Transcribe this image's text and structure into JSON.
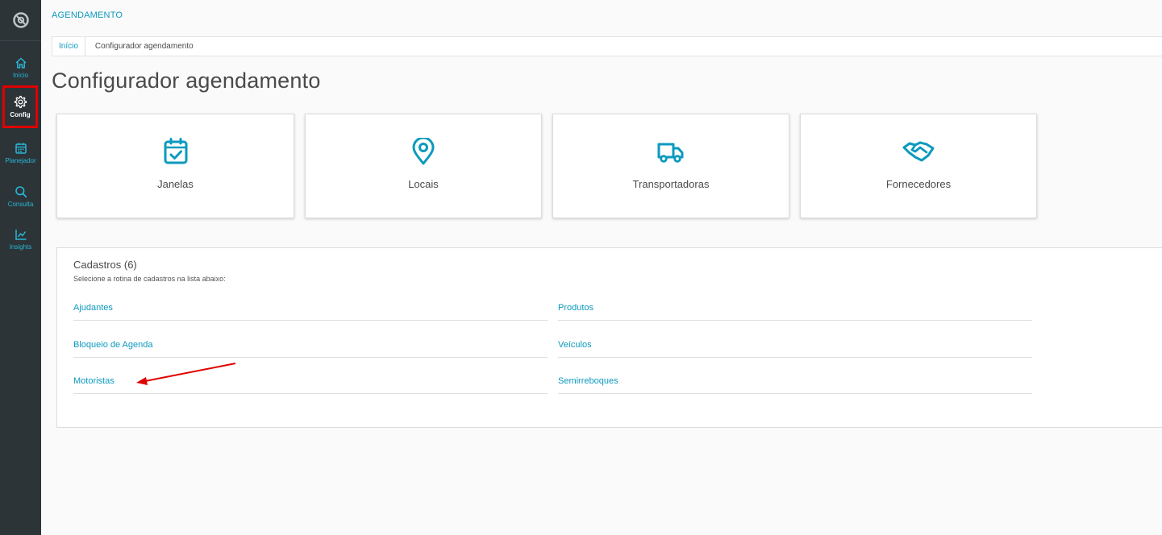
{
  "sidebar": {
    "logo_icon": "logo-icon",
    "items": [
      {
        "label": "Início",
        "icon": "home-icon"
      },
      {
        "label": "Config",
        "icon": "gear-icon"
      },
      {
        "label": "Planejador",
        "icon": "calendar-icon"
      },
      {
        "label": "Consulta",
        "icon": "search-icon"
      },
      {
        "label": "Insights",
        "icon": "chart-icon"
      }
    ],
    "active": "Config"
  },
  "header": {
    "app_title": "AGENDAMENTO"
  },
  "breadcrumb": {
    "home": "Início",
    "current": "Configurador agendamento"
  },
  "page_title": "Configurador agendamento",
  "cards": [
    {
      "label": "Janelas",
      "icon": "calendar-check-icon"
    },
    {
      "label": "Locais",
      "icon": "map-pin-icon"
    },
    {
      "label": "Transportadoras",
      "icon": "truck-icon"
    },
    {
      "label": "Fornecedores",
      "icon": "handshake-icon"
    }
  ],
  "cadastros": {
    "title": "Cadastros (6)",
    "subtitle": "Selecione a rotina de cadastros na lista abaixo:",
    "links": [
      "Ajudantes",
      "Produtos",
      "Bloqueio de Agenda",
      "Veículos",
      "Motoristas",
      "Semirreboques"
    ]
  },
  "colors": {
    "accent": "#0c9abe",
    "sidebar": "#2c3438",
    "annotation": "#e00000"
  }
}
